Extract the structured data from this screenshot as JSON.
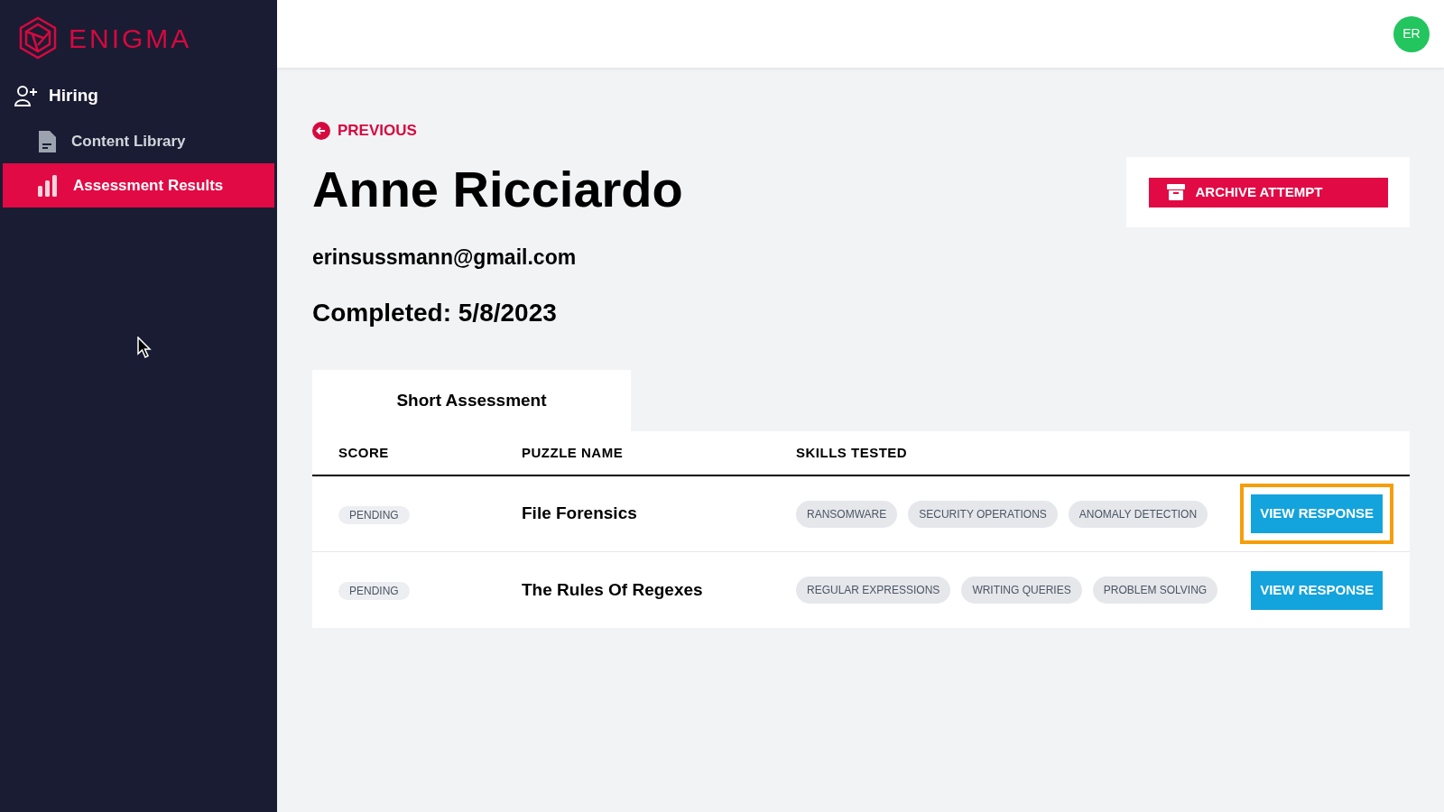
{
  "brand": {
    "name": "ENIGMA"
  },
  "user": {
    "initials": "ER"
  },
  "sidebar": {
    "section": "Hiring",
    "items": [
      {
        "label": "Content Library",
        "kind": "document",
        "selected": false
      },
      {
        "label": "Assessment Results",
        "kind": "chart",
        "selected": true
      }
    ]
  },
  "back_link": "PREVIOUS",
  "candidate": {
    "name": "Anne Ricciardo",
    "email": "erinsussmann@gmail.com",
    "completed": "Completed: 5/8/2023"
  },
  "archive_button": "ARCHIVE ATTEMPT",
  "tabs": [
    {
      "label": "Short Assessment",
      "selected": true
    }
  ],
  "table": {
    "columns": [
      "SCORE",
      "PUZZLE NAME",
      "SKILLS TESTED"
    ],
    "rows": [
      {
        "score": "PENDING",
        "puzzle": "File Forensics",
        "skills": [
          "RANSOMWARE",
          "SECURITY OPERATIONS",
          "ANOMALY DETECTION"
        ],
        "action": "VIEW RESPONSE",
        "highlighted": true
      },
      {
        "score": "PENDING",
        "puzzle": "The Rules Of Regexes",
        "skills": [
          "REGULAR EXPRESSIONS",
          "WRITING QUERIES",
          "PROBLEM SOLVING"
        ],
        "action": "VIEW RESPONSE",
        "highlighted": false
      }
    ]
  }
}
